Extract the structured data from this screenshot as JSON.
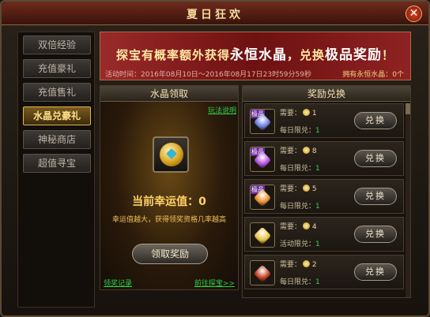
{
  "window": {
    "title": "夏日狂欢",
    "close": "✕"
  },
  "sidebar": {
    "items": [
      {
        "label": "双倍经验",
        "active": false
      },
      {
        "label": "充值豪礼",
        "active": false
      },
      {
        "label": "充值售礼",
        "active": false
      },
      {
        "label": "水晶兑豪礼",
        "active": true
      },
      {
        "label": "神秘商店",
        "active": false
      },
      {
        "label": "超值寻宝",
        "active": false
      }
    ]
  },
  "banner": {
    "headline_a": "探宝有概率额外获得",
    "headline_b": "永恒水晶",
    "headline_c": "，兑换",
    "headline_d": "极品奖励",
    "headline_e": "！",
    "time_text": "活动时间：2016年08月10日～2016年08月17日23时59分59秒",
    "crystal_count": "拥有永恒水晶：0个"
  },
  "crystal_panel": {
    "title": "水晶领取",
    "rules_link": "玩法说明",
    "luck_label": "当前幸运值：0",
    "luck_desc": "幸运值越大，获得领奖资格几率越高",
    "claim_button": "领取奖励",
    "record_link": "领奖记录",
    "treasure_link": "前往探宝>>"
  },
  "rewards_panel": {
    "title": "奖励兑换",
    "cost_label": "需要：",
    "rows": [
      {
        "badge": "极品",
        "cost": "1",
        "limit_label": "每日限兑：",
        "limit": "1",
        "button": "兑换",
        "gem_color": "#6a7ee0"
      },
      {
        "badge": "极品",
        "cost": "8",
        "limit_label": "每日限兑：",
        "limit": "1",
        "button": "兑换",
        "gem_color": "#b24ad8"
      },
      {
        "badge": "极品",
        "cost": "5",
        "limit_label": "每日限兑：",
        "limit": "1",
        "button": "兑换",
        "gem_color": "#e8902a"
      },
      {
        "badge": "",
        "cost": "4",
        "limit_label": "活动限兑：",
        "limit": "1",
        "button": "兑换",
        "gem_color": "#e8c040"
      },
      {
        "badge": "",
        "cost": "2",
        "limit_label": "每日限兑：",
        "limit": "1",
        "button": "兑换",
        "gem_color": "#c04020"
      }
    ]
  }
}
